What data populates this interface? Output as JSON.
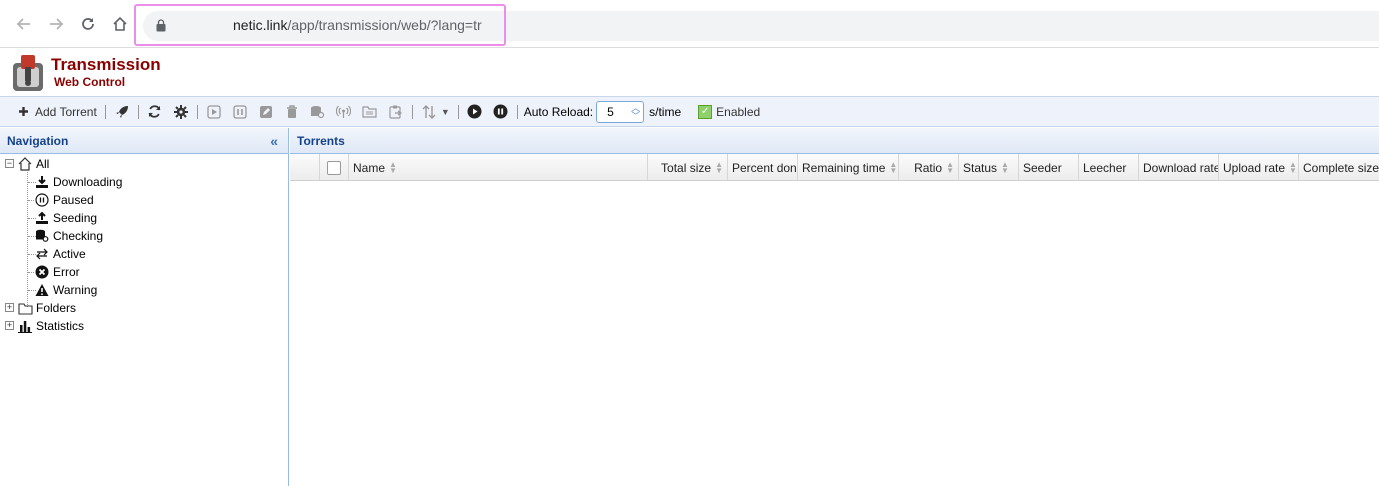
{
  "browser": {
    "url_host": "netic.link",
    "url_path": "/app/transmission/web/?lang=tr"
  },
  "app": {
    "title": "Transmission",
    "subtitle": "Web Control"
  },
  "toolbar": {
    "add_torrent": "Add Torrent",
    "auto_reload_label": "Auto Reload:",
    "auto_reload_value": "5",
    "unit": "s/time",
    "enabled_label": "Enabled"
  },
  "navigation": {
    "title": "Navigation",
    "all": "All",
    "items": [
      "Downloading",
      "Paused",
      "Seeding",
      "Checking",
      "Active",
      "Error",
      "Warning"
    ],
    "folders": "Folders",
    "statistics": "Statistics"
  },
  "torrents": {
    "title": "Torrents",
    "columns": [
      "Name",
      "Total size",
      "Percent don",
      "Remaining time",
      "Ratio",
      "Status",
      "Seeder",
      "Leecher",
      "Download rate",
      "Upload rate",
      "Complete size"
    ]
  },
  "colors": {
    "brand": "#8b0000",
    "header_text": "#15428b",
    "highlight": "#ea8ee8"
  }
}
